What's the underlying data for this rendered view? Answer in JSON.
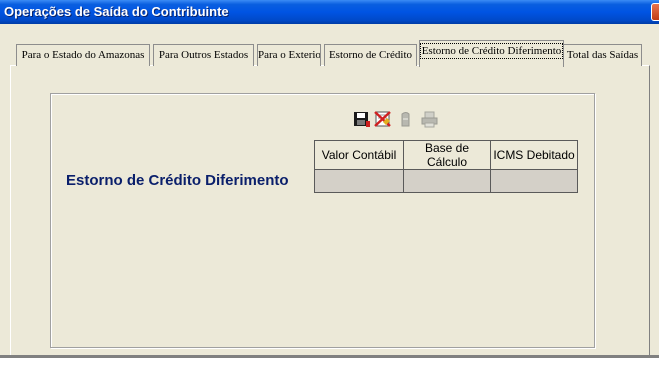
{
  "window": {
    "title": "Operações de Saída do Contribuinte"
  },
  "tabs": [
    {
      "label": "Para o Estado do Amazonas",
      "active": false
    },
    {
      "label": "Para Outros Estados",
      "active": false
    },
    {
      "label": "Para o Exterior",
      "active": false
    },
    {
      "label": "Estorno de Crédito",
      "active": false
    },
    {
      "label": "Estorno de Crédito Diferimento",
      "active": true
    },
    {
      "label": "Total das Saídas",
      "active": false
    }
  ],
  "section": {
    "title": "Estorno de Crédito Diferimento"
  },
  "toolbar": [
    {
      "icon": "save-icon",
      "enabled": true
    },
    {
      "icon": "cancel-icon",
      "enabled": true
    },
    {
      "icon": "delete-icon",
      "enabled": false
    },
    {
      "icon": "print-icon",
      "enabled": false
    }
  ],
  "grid": {
    "columns": [
      "Valor Contábil",
      "Base de Cálculo",
      "ICMS Debitado"
    ],
    "rows": [
      [
        "",
        "",
        ""
      ]
    ]
  }
}
